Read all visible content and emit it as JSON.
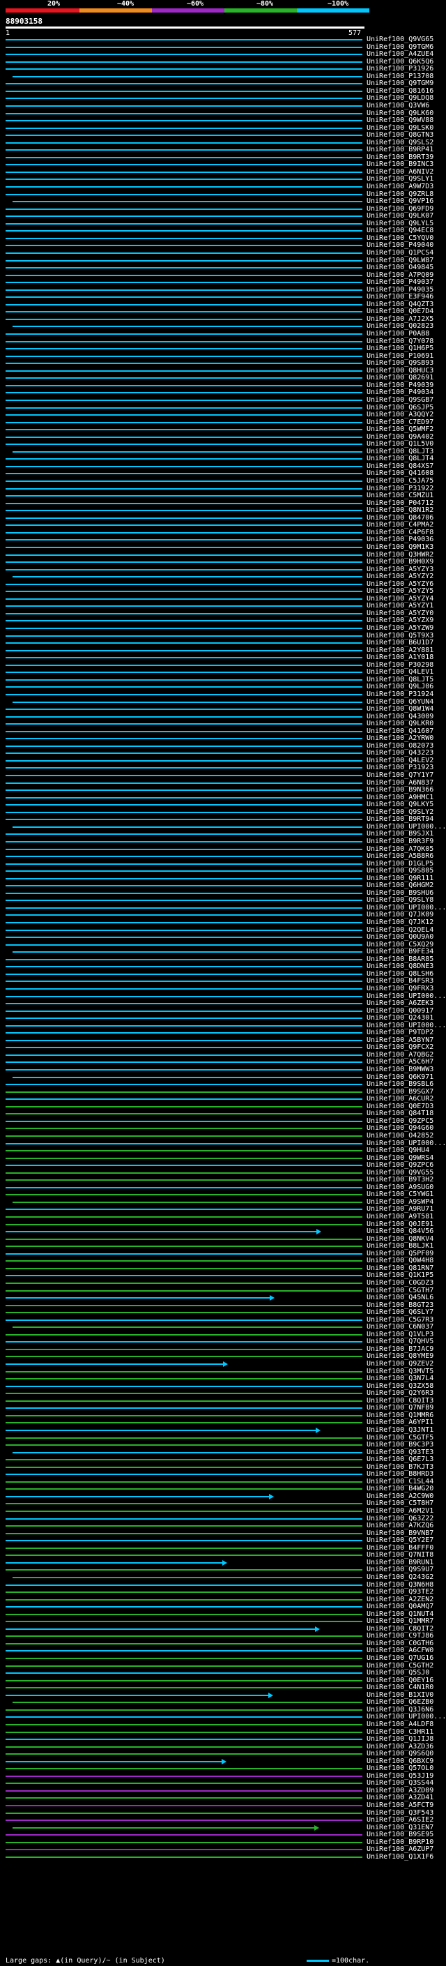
{
  "scale": {
    "labels": [
      "20%",
      "~40%",
      "~60%",
      "~80%",
      "~100%"
    ],
    "colors": [
      "#e8141e",
      "#f08c1e",
      "#a028c8",
      "#28b428",
      "#00c8ff"
    ]
  },
  "query": {
    "id": "88903158",
    "start": "1",
    "end": "577"
  },
  "hits": [
    "UniRef100_Q9VG65",
    "UniRef100_Q9TGM6",
    "UniRef100_A4ZUE4",
    "UniRef100_Q6K5Q6",
    "UniRef100_P31926",
    "UniRef100_P13708",
    "UniRef100_Q9TGM9",
    "UniRef100_Q81616",
    "UniRef100_Q9LDQ8",
    "UniRef100_Q3VW6",
    "UniRef100_Q9LK60",
    "UniRef100_Q9WV88",
    "UniRef100_Q9LSK0",
    "UniRef100_Q8GTN3",
    "UniRef100_Q9SLS2",
    "UniRef100_B9RP41",
    "UniRef100_B9RT39",
    "UniRef100_B9INC3",
    "UniRef100_A6NIV2",
    "UniRef100_Q9SLY1",
    "UniRef100_A9W7D3",
    "UniRef100_Q9ZRL8",
    "UniRef100_Q9VP16",
    "UniRef100_Q69FD9",
    "UniRef100_Q9LK07",
    "UniRef100_Q9LYL5",
    "UniRef100_Q94EC8",
    "UniRef100_C5YQV0",
    "UniRef100_P49040",
    "UniRef100_Q1PCS4",
    "UniRef100_Q9LW87",
    "UniRef100_O49845",
    "UniRef100_A7PQ09",
    "UniRef100_P49037",
    "UniRef100_P49035",
    "UniRef100_E3F946",
    "UniRef100_Q4QZT3",
    "UniRef100_Q0E7D4",
    "UniRef100_A7J2X5",
    "UniRef100_Q02823",
    "UniRef100_P0AB8",
    "UniRef100_Q7Y078",
    "UniRef100_Q1H6P5",
    "UniRef100_P10691",
    "UniRef100_Q9SB93",
    "UniRef100_Q8HUC3",
    "UniRef100_Q82691",
    "UniRef100_P49039",
    "UniRef100_P49034",
    "UniRef100_Q9SGB7",
    "UniRef100_Q6SJP5",
    "UniRef100_A3QQY2",
    "UniRef100_C7ED97",
    "UniRef100_Q5WMF2",
    "UniRef100_Q9A402",
    "UniRef100_Q1L5V0",
    "UniRef100_Q8LJT3",
    "UniRef100_Q8LJT4",
    "UniRef100_Q84XS7",
    "UniRef100_Q41608",
    "UniRef100_C5JA75",
    "UniRef100_P31922",
    "UniRef100_C5MZU1",
    "UniRef100_P04712",
    "UniRef100_Q8N1R2",
    "UniRef100_Q84706",
    "UniRef100_C4PMA2",
    "UniRef100_C4P6F8",
    "UniRef100_P49036",
    "UniRef100_Q9M1K3",
    "UniRef100_Q3HWR2",
    "UniRef100_B9H0X9",
    "UniRef100_A5YZY3",
    "UniRef100_A5YZY2",
    "UniRef100_A5YZY6",
    "UniRef100_A5YZY5",
    "UniRef100_A5YZY4",
    "UniRef100_A5YZY1",
    "UniRef100_A5YZY0",
    "UniRef100_A5YZX9",
    "UniRef100_A5YZW9",
    "UniRef100_Q5T9X3",
    "UniRef100_B6U1D7",
    "UniRef100_A2Y881",
    "UniRef100_A1Y018",
    "UniRef100_P30298",
    "UniRef100_Q4LEV1",
    "UniRef100_Q8LJT5",
    "UniRef100_Q9LJ06",
    "UniRef100_P31924",
    "UniRef100_Q6YUN4",
    "UniRef100_Q8W1W4",
    "UniRef100_Q43009",
    "UniRef100_Q9LKR0",
    "UniRef100_Q41607",
    "UniRef100_A2YRW0",
    "UniRef100_O82073",
    "UniRef100_Q43223",
    "UniRef100_Q4LEV2",
    "UniRef100_P31923",
    "UniRef100_Q7Y1Y7",
    "UniRef100_A6N837",
    "UniRef100_B9N366",
    "UniRef100_A9HMC1",
    "UniRef100_Q9LKY5",
    "UniRef100_Q9SLY2",
    "UniRef100_B9RT94",
    "UniRef100_UPI000...",
    "UniRef100_B9SJX1",
    "UniRef100_B9R3F9",
    "UniRef100_A7QK05",
    "UniRef100_A5B8R6",
    "UniRef100_D1GLP5",
    "UniRef100_Q9S805",
    "UniRef100_Q9R111",
    "UniRef100_Q6HGM2",
    "UniRef100_B9SHU6",
    "UniRef100_Q9SLY8",
    "UniRef100_UPI000...",
    "UniRef100_Q7JK09",
    "UniRef100_Q7JK12",
    "UniRef100_Q2QEL4",
    "UniRef100_Q0U9A0",
    "UniRef100_C5XQ29",
    "UniRef100_B9FE34",
    "UniRef100_B8AR85",
    "UniRef100_Q8DNE3",
    "UniRef100_Q8LSH6",
    "UniRef100_B4FSR3",
    "UniRef100_Q9FRX3",
    "UniRef100_UPI000...",
    "UniRef100_A6ZEK3",
    "UniRef100_Q00917",
    "UniRef100_Q24301",
    "UniRef100_UPI000...",
    "UniRef100_P9TDP2",
    "UniRef100_A5BYN7",
    "UniRef100_Q9FCX2",
    "UniRef100_A7QBG2",
    "UniRef100_A5C6H7",
    "UniRef100_B9MWW3",
    "UniRef100_Q6K971",
    "UniRef100_B9SBL6",
    "UniRef100_B9SGX7",
    "UniRef100_A6CUR2",
    "UniRef100_Q0E7D3",
    "UniRef100_Q84T18",
    "UniRef100_Q9ZPC5",
    "UniRef100_Q94G60",
    "UniRef100_O42852",
    "UniRef100_UPI000...",
    "UniRef100_Q9HU4",
    "UniRef100_Q9WRS4",
    "UniRef100_Q9ZPC6",
    "UniRef100_Q9VG55",
    "UniRef100_B9T3H2",
    "UniRef100_A9SUG0",
    "UniRef100_C5YWG1",
    "UniRef100_A9SWP4",
    "UniRef100_A9RU71",
    "UniRef100_A9T581",
    "UniRef100_Q0JE91",
    "UniRef100_Q84V56",
    "UniRef100_Q8NKV4",
    "UniRef100_B8LJK1",
    "UniRef100_Q5PF09",
    "UniRef100_Q0W4H8",
    "UniRef100_Q81RN7",
    "UniRef100_Q1K1P5",
    "UniRef100_C0GDZ3",
    "UniRef100_C5GTH7",
    "UniRef100_Q45NL6",
    "UniRef100_B8GT23",
    "UniRef100_Q6SLY7",
    "UniRef100_C5G7R3",
    "UniRef100_C6N037",
    "UniRef100_Q1VLP3",
    "UniRef100_Q7QHV5",
    "UniRef100_B7JAC9",
    "UniRef100_Q8YME9",
    "UniRef100_Q9ZEV2",
    "UniRef100_Q3MVT5",
    "UniRef100_Q3N7L4",
    "UniRef100_Q3ZX58",
    "UniRef100_Q2Y6R3",
    "UniRef100_C8QIT3",
    "UniRef100_Q7NFB9",
    "UniRef100_Q1MMR6",
    "UniRef100_A6YPI1",
    "UniRef100_Q3JNT1",
    "UniRef100_C5GTF5",
    "UniRef100_B9C3P3",
    "UniRef100_Q93TE3",
    "UniRef100_Q6E7L3",
    "UniRef100_B7KJT3",
    "UniRef100_B8HRD3",
    "UniRef100_C1SL44",
    "UniRef100_B4WG20",
    "UniRef100_A2C9W0",
    "UniRef100_C5T8H7",
    "UniRef100_A6M2V1",
    "UniRef100_Q63Z22",
    "UniRef100_A7KZQ6",
    "UniRef100_B9VNB7",
    "UniRef100_Q5Y2E7",
    "UniRef100_B4FFF0",
    "UniRef100_Q7NIT8",
    "UniRef100_B9RUN1",
    "UniRef100_Q9S9U7",
    "UniRef100_Q243G2",
    "UniRef100_Q3N6H8",
    "UniRef100_Q93TE2",
    "UniRef100_A2ZEN2",
    "UniRef100_Q0AMQ7",
    "UniRef100_Q1NUT4",
    "UniRef100_Q1MMR7",
    "UniRef100_C8QIT2",
    "UniRef100_C9TJ86",
    "UniRef100_C0GTH6",
    "UniRef100_A6CFW0",
    "UniRef100_Q7UG16",
    "UniRef100_C5GTH2",
    "UniRef100_Q5SJ0",
    "UniRef100_Q0EY16",
    "UniRef100_C4N1R0",
    "UniRef100_B1XIV0",
    "UniRef100_Q6EZB0",
    "UniRef100_Q3J6N6",
    "UniRef100_UPI000...",
    "UniRef100_A4LDF8",
    "UniRef100_C3HR11",
    "UniRef100_Q1JIJ8",
    "UniRef100_A3ZD36",
    "UniRef100_Q9S6Q0",
    "UniRef100_Q6BXC9",
    "UniRef100_Q57OL0",
    "UniRef100_Q53J19",
    "UniRef100_Q3SS44",
    "UniRef100_A3ZD09",
    "UniRef100_A3ZD41",
    "UniRef100_A5FCT9",
    "UniRef100_Q3F543",
    "UniRef100_A6SIE2",
    "UniRef100_Q31EN7",
    "UniRef100_B9SE95",
    "UniRef100_B9RP10",
    "UniRef100_A6ZUP7",
    "UniRef100_Q1X1F6"
  ],
  "legend": {
    "left": "Large gaps: ▲(in Query)/~ (in Subject)",
    "right": "=100char."
  }
}
